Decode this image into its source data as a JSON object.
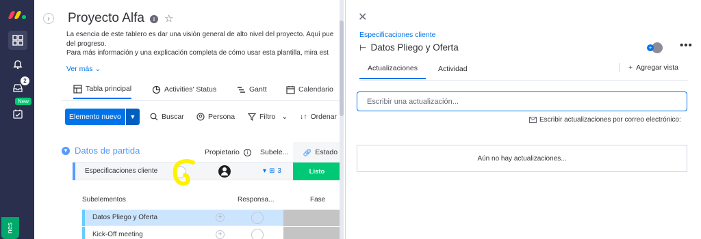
{
  "rail": {
    "notifications_badge": "2",
    "new_badge": "New",
    "help_label": "nes",
    "logo_colors": [
      "#ff3d57",
      "#ffcb00",
      "#00ca72"
    ]
  },
  "board": {
    "title": "Proyecto Alfa",
    "description_lines": [
      "La esencia de este tablero es dar una visión general de alto nivel del proyecto. Aquí pue",
      "del progreso.",
      "Para más información y una explicación completa de cómo usar esta plantilla, mira est"
    ],
    "ver_mas": "Ver más",
    "tabs": [
      "Tabla principal",
      "Activities' Status",
      "Gantt",
      "Calendario"
    ],
    "toolbar": {
      "new_item": "Elemento nuevo",
      "search": "Buscar",
      "person": "Persona",
      "filter": "Filtro",
      "sort": "Ordenar"
    },
    "group": {
      "title": "Datos de partida",
      "columns": {
        "owner": "Propietario",
        "subitems": "Subele...",
        "status": "Estado"
      },
      "item": {
        "name": "Especificaciones cliente",
        "subitem_count": "3",
        "status": "Listo"
      }
    },
    "subitems": {
      "headers": {
        "name": "Subelementos",
        "responsible": "Responsa...",
        "phase": "Fase"
      },
      "rows": [
        {
          "name": "Datos Pliego y Oferta"
        },
        {
          "name": "Kick-Off meeting"
        }
      ]
    }
  },
  "panel": {
    "parent": "Especificaciones cliente",
    "title": "Datos Pliego y Oferta",
    "tabs": [
      "Actualizaciones",
      "Actividad"
    ],
    "add_view": "Agregar vista",
    "update_placeholder": "Escribir una actualización...",
    "email_updates": "Escribir actualizaciones por correo electrónico:",
    "empty_text": "Aún no hay actualizaciones..."
  },
  "colors": {
    "accent": "#0073ea",
    "group": "#579bfc",
    "status_done": "#00c875",
    "rail": "#292f4c"
  }
}
